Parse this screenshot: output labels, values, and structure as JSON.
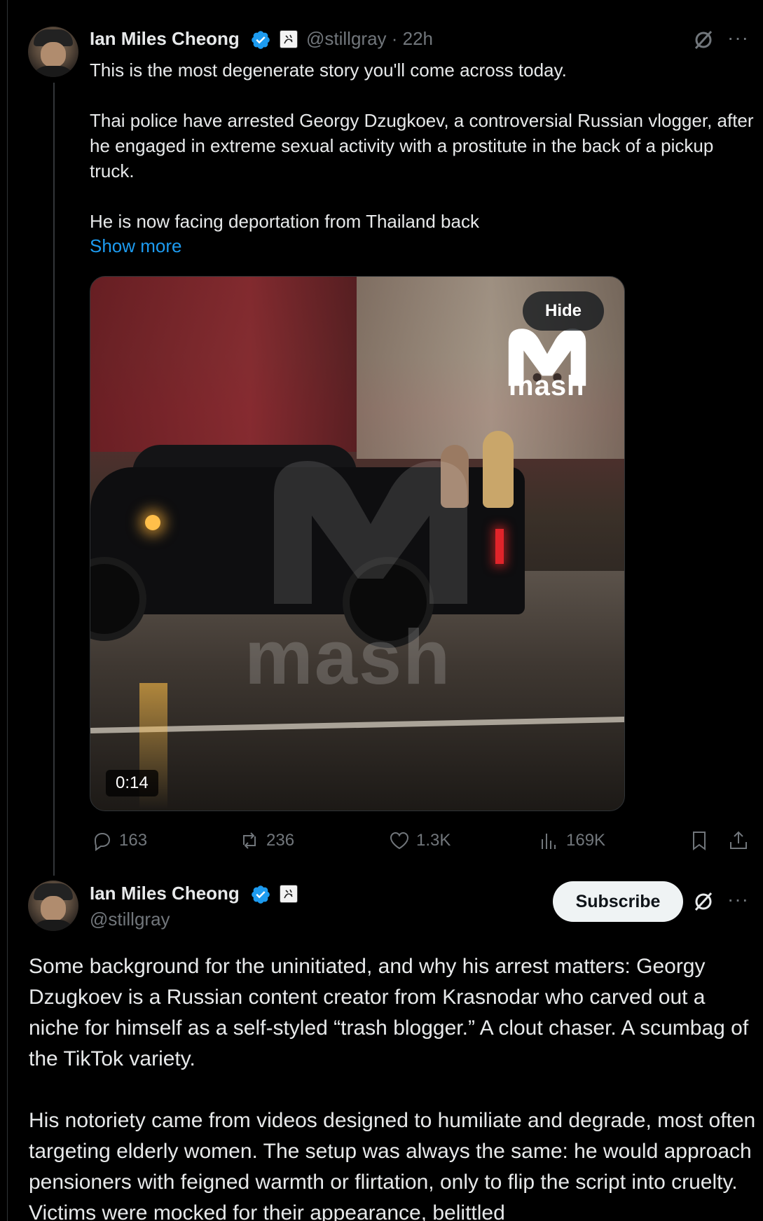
{
  "tweet1": {
    "author_name": "Ian Miles Cheong",
    "handle_time": "@stillgray · 22h",
    "paragraphs": [
      "This is the most degenerate story you'll come across today.",
      "Thai police have arrested Georgy Dzugkoev, a controversial Russian vlogger, after he engaged in extreme sexual activity with a prostitute in the back of a pickup truck.",
      "He is now facing deportation from Thailand back"
    ],
    "show_more": "Show more",
    "media": {
      "hide_label": "Hide",
      "duration": "0:14",
      "watermark": "mash"
    },
    "actions": {
      "replies": "163",
      "reposts": "236",
      "likes": "1.3K",
      "views": "169K"
    }
  },
  "tweet2": {
    "author_name": "Ian Miles Cheong",
    "handle": "@stillgray",
    "subscribe_label": "Subscribe",
    "paragraphs": [
      "Some background for the uninitiated, and why his arrest matters: Georgy Dzugkoev is a Russian content creator from Krasnodar who carved out a niche for himself as a self-styled “trash blogger.” A clout chaser. A scumbag of the TikTok variety.",
      "His notoriety came from videos designed to humiliate and degrade, most often targeting elderly women. The setup was always the same: he would approach pensioners with feigned warmth or flirtation, only to flip the script into cruelty. Victims were mocked for their appearance, belittled"
    ]
  },
  "icons": {
    "verified": "verified-badge-icon",
    "affiliation": "affiliation-badge-icon",
    "grok": "grok-icon",
    "more": "more-icon",
    "reply": "reply-icon",
    "repost": "repost-icon",
    "like": "like-icon",
    "views": "views-icon",
    "bookmark": "bookmark-icon",
    "share": "share-icon"
  },
  "colors": {
    "background": "#000000",
    "text": "#e7e9ea",
    "secondary": "#71767b",
    "link": "#1d9bf0",
    "verified": "#1d9bf0"
  }
}
